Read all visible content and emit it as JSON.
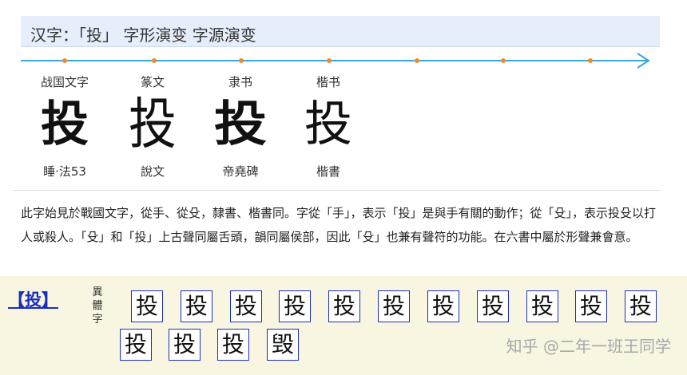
{
  "title": "汉字：「投」 字形演变 字源演变",
  "stages": [
    {
      "label": "战国文字",
      "glyph": "投",
      "source": "睡·法53"
    },
    {
      "label": "篆文",
      "glyph": "投",
      "source": "說文"
    },
    {
      "label": "隶书",
      "glyph": "投",
      "source": "帝堯碑"
    },
    {
      "label": "楷书",
      "glyph": "投",
      "source": "楷書"
    }
  ],
  "description": "此字始見於戰國文字，從手、從殳，隸書、楷書同。字從「手」，表示「投」是與手有關的動作；從「殳」，表示投殳以打人或殺人。「殳」和「投」上古聲同屬舌頭，韻同屬侯部，因此「殳」也兼有聲符的功能。在六書中屬於形聲兼會意。",
  "variants": {
    "char_link": "【投】",
    "label": "異體字",
    "items": [
      "投",
      "投",
      "投",
      "投",
      "投",
      "投",
      "投",
      "投",
      "投",
      "投",
      "投",
      "投",
      "投",
      "投",
      "毁"
    ]
  },
  "watermark": "知乎 @二年一班王同学",
  "colors": {
    "timeline": "#3aa6dc",
    "timeline_dot": "#f08a2c",
    "title_bg": "#e6eefb",
    "variant_bg": "#f8f5e0",
    "link": "#1a2ec0"
  }
}
